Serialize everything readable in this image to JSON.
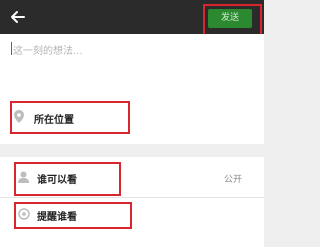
{
  "header": {
    "send_label": "发送"
  },
  "compose": {
    "placeholder": "这一刻的想法..."
  },
  "options": {
    "location_label": "所在位置",
    "visibility_label": "谁可以看",
    "visibility_value": "公开",
    "remind_label": "提醒谁看"
  },
  "colors": {
    "topbar": "#2b2b2b",
    "send_button": "#2b8a2f",
    "highlight_box": "#d8262e",
    "background": "#efefef"
  },
  "icons": [
    "back-arrow-icon",
    "location-pin-icon",
    "person-icon",
    "at-icon"
  ]
}
